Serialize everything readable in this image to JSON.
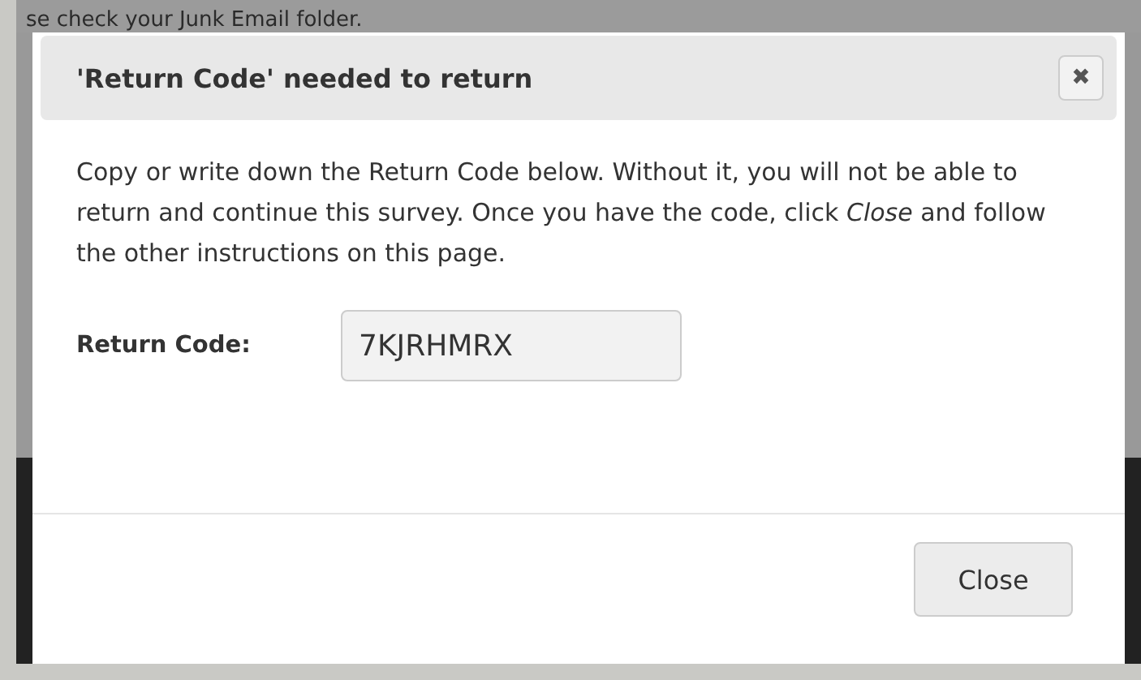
{
  "background": {
    "notice": "se check your Junk Email folder."
  },
  "dialog": {
    "title": "'Return Code' needed to return",
    "close_icon": "✖",
    "message": "Copy or write down the Return Code below. Without it, you will not be able to return and continue this survey. Once you have the code, click *Close* and follow the other instructions on this page.",
    "field": {
      "label": "Return Code:",
      "value": "7KJRHMRX"
    },
    "buttons": [
      "Close"
    ]
  }
}
